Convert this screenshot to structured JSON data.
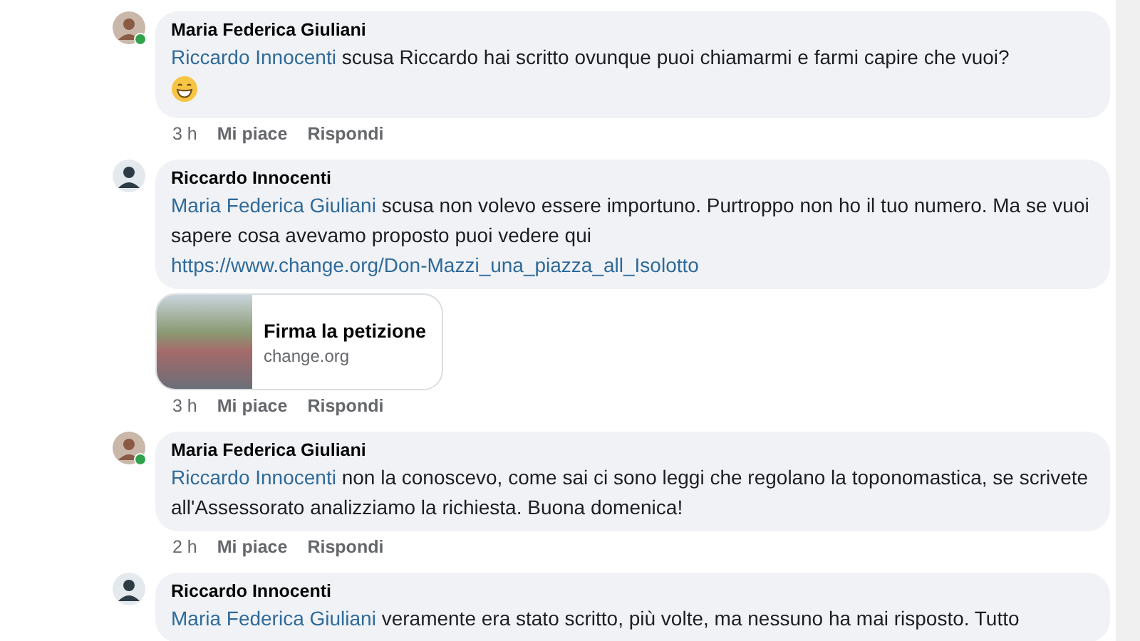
{
  "comments": [
    {
      "author": "Maria Federica Giuliani",
      "online": true,
      "mention": "Riccardo Innocenti",
      "text": "scusa Riccardo hai scritto ovunque puoi chiamarmi e farmi capire che vuoi?",
      "emoji": true,
      "time": "3 h",
      "like": "Mi piace",
      "reply": "Rispondi"
    },
    {
      "author": "Riccardo Innocenti",
      "online": false,
      "mention": "Maria Federica Giuliani",
      "text": "scusa non volevo essere importuno. Purtroppo non ho il tuo numero. Ma se vuoi sapere cosa avevamo proposto puoi vedere qui",
      "link": "https://www.change.org/Don-Mazzi_una_piazza_all_Isolotto",
      "preview": {
        "title": "Firma la petizione",
        "domain": "change.org"
      },
      "time": "3 h",
      "like": "Mi piace",
      "reply": "Rispondi"
    },
    {
      "author": "Maria Federica Giuliani",
      "online": true,
      "mention": "Riccardo Innocenti",
      "text": "non la conoscevo, come sai ci sono leggi che regolano la toponomastica, se scrivete all'Assessorato analizziamo la richiesta. Buona domenica!",
      "time": "2 h",
      "like": "Mi piace",
      "reply": "Rispondi"
    },
    {
      "author": "Riccardo Innocenti",
      "online": false,
      "mention": "Maria Federica Giuliani",
      "text": "veramente era stato scritto, più volte, ma nessuno ha mai risposto. Tutto"
    }
  ]
}
